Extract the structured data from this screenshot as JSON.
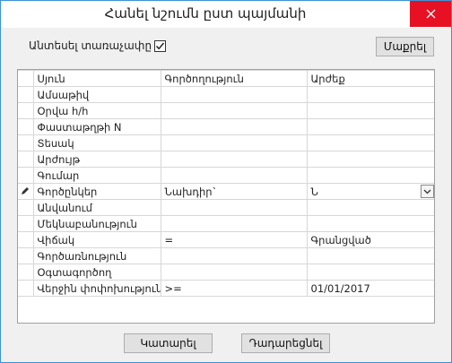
{
  "window": {
    "title": "Հանել նշումն ըստ պայմանի"
  },
  "toolbar": {
    "show_filter_label": "Անտեսել տառաչափը",
    "show_filter_checked": true,
    "clear_button": "Մաքրել"
  },
  "grid": {
    "headers": [
      "Սյուն",
      "Գործողություն",
      "Արժեք"
    ],
    "rows": [
      {
        "column": "Ամսաթիվ",
        "operation": "",
        "value": ""
      },
      {
        "column": "Օրվա հ/հ",
        "operation": "",
        "value": ""
      },
      {
        "column": "Փաստաթղթի N",
        "operation": "",
        "value": ""
      },
      {
        "column": "Տեսակ",
        "operation": "",
        "value": ""
      },
      {
        "column": "Արժույթ",
        "operation": "",
        "value": ""
      },
      {
        "column": "Գումար",
        "operation": "",
        "value": ""
      },
      {
        "column": "Գործընկեր",
        "operation": "Նախդիր`",
        "value": "Ն",
        "editing": true
      },
      {
        "column": "Անվանում",
        "operation": "",
        "value": ""
      },
      {
        "column": "Մեկնաբանություն",
        "operation": "",
        "value": ""
      },
      {
        "column": "Վիճակ",
        "operation": "=",
        "value": "Գրանցված"
      },
      {
        "column": "Գործառնություն",
        "operation": "",
        "value": ""
      },
      {
        "column": "Օգտագործող",
        "operation": "",
        "value": ""
      },
      {
        "column": "Վերջին փոփոխություն",
        "operation": ">=",
        "value": "01/01/2017"
      }
    ]
  },
  "footer": {
    "ok_button": "Կատարել",
    "cancel_button": "Դադարեցնել"
  },
  "colors": {
    "close": "#e81123",
    "border": "#3c93d6",
    "grid_line": "#d7d7d7"
  }
}
